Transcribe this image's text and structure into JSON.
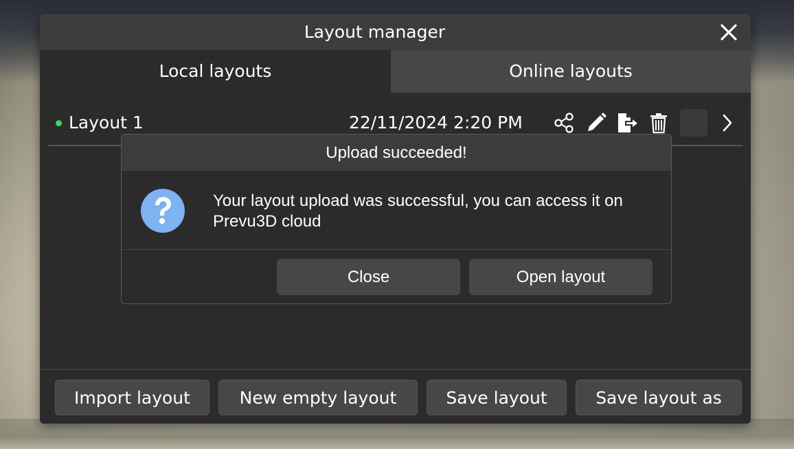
{
  "window": {
    "title": "Layout manager",
    "close_icon": "close-icon"
  },
  "tabs": [
    {
      "label": "Local layouts",
      "active": true
    },
    {
      "label": "Online layouts",
      "active": false
    }
  ],
  "layouts": [
    {
      "name": "Layout 1",
      "status_color": "#3fd45a",
      "date": "22/11/2024 2:20 PM",
      "icons": [
        "share-icon",
        "edit-icon",
        "export-icon",
        "delete-icon",
        "chevron-right-icon"
      ]
    }
  ],
  "dialog": {
    "title": "Upload succeeded!",
    "icon": "question-icon",
    "icon_color": "#7fb2f0",
    "message": "Your layout upload was successful, you can access it on Prevu3D cloud",
    "close_label": "Close",
    "open_label": "Open layout"
  },
  "footer": {
    "import_label": "Import layout",
    "new_label": "New empty layout",
    "save_label": "Save layout",
    "save_as_label": "Save layout as"
  }
}
